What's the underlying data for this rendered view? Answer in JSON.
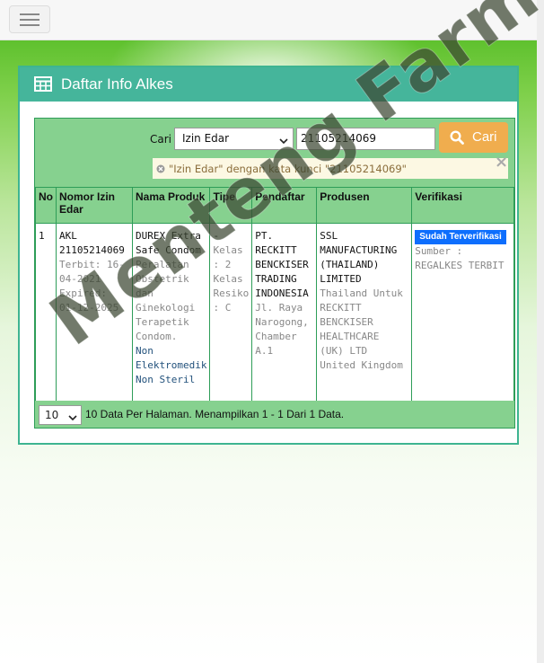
{
  "panel": {
    "title": "Daftar Info Alkes"
  },
  "search": {
    "label": "Cari",
    "select_value": "Izin Edar",
    "input_value": "21105214069",
    "button_label": "Cari",
    "alert_text": "\"Izin Edar\" dengan kata kunci \"21105214069\"",
    "alert_close": "×"
  },
  "table": {
    "headers": [
      "No",
      "Nomor Izin Edar",
      "Nama Produk",
      "Tipe",
      "Pendaftar",
      "Produsen",
      "Verifikasi"
    ],
    "row": {
      "no": "1",
      "izin_main": "AKL 21105214069",
      "terbit": "Terbit: 16-04-2021",
      "expired": "Expired: 01-12-2025",
      "produk_name": "DUREX Extra Safe Condom",
      "produk_desc": "Peralatan Obstetrik dan Ginekologi Terapetik Condom.",
      "produk_class": "Non Elektromedik Non Steril",
      "tipe_dash": "-",
      "tipe_detail": "Kelas : 2 Kelas Resiko : C",
      "pendaftar_name": "PT. RECKITT BENCKISER TRADING INDONESIA",
      "pendaftar_addr": "Jl. Raya Narogong, Chamber A.1",
      "produsen_name": "SSL MANUFACTURING (THAILAND) LIMITED",
      "produsen_detail": "Thailand Untuk RECKITT BENCKISER HEALTHCARE (UK) LTD United Kingdom",
      "verif_badge": "Sudah Terverifikasi",
      "verif_source": "Sumber : REGALKES TERBIT"
    }
  },
  "footer": {
    "per_page": "10",
    "text": "10 Data Per Halaman. Menampilkan 1 - 1 Dari 1 Data."
  },
  "watermark": "Menteng Farma",
  "colors": {
    "panel_header": "#45b59b",
    "table_header": "#86d18f",
    "search_button": "#f0ad4e",
    "badge": "#0d6efd"
  }
}
